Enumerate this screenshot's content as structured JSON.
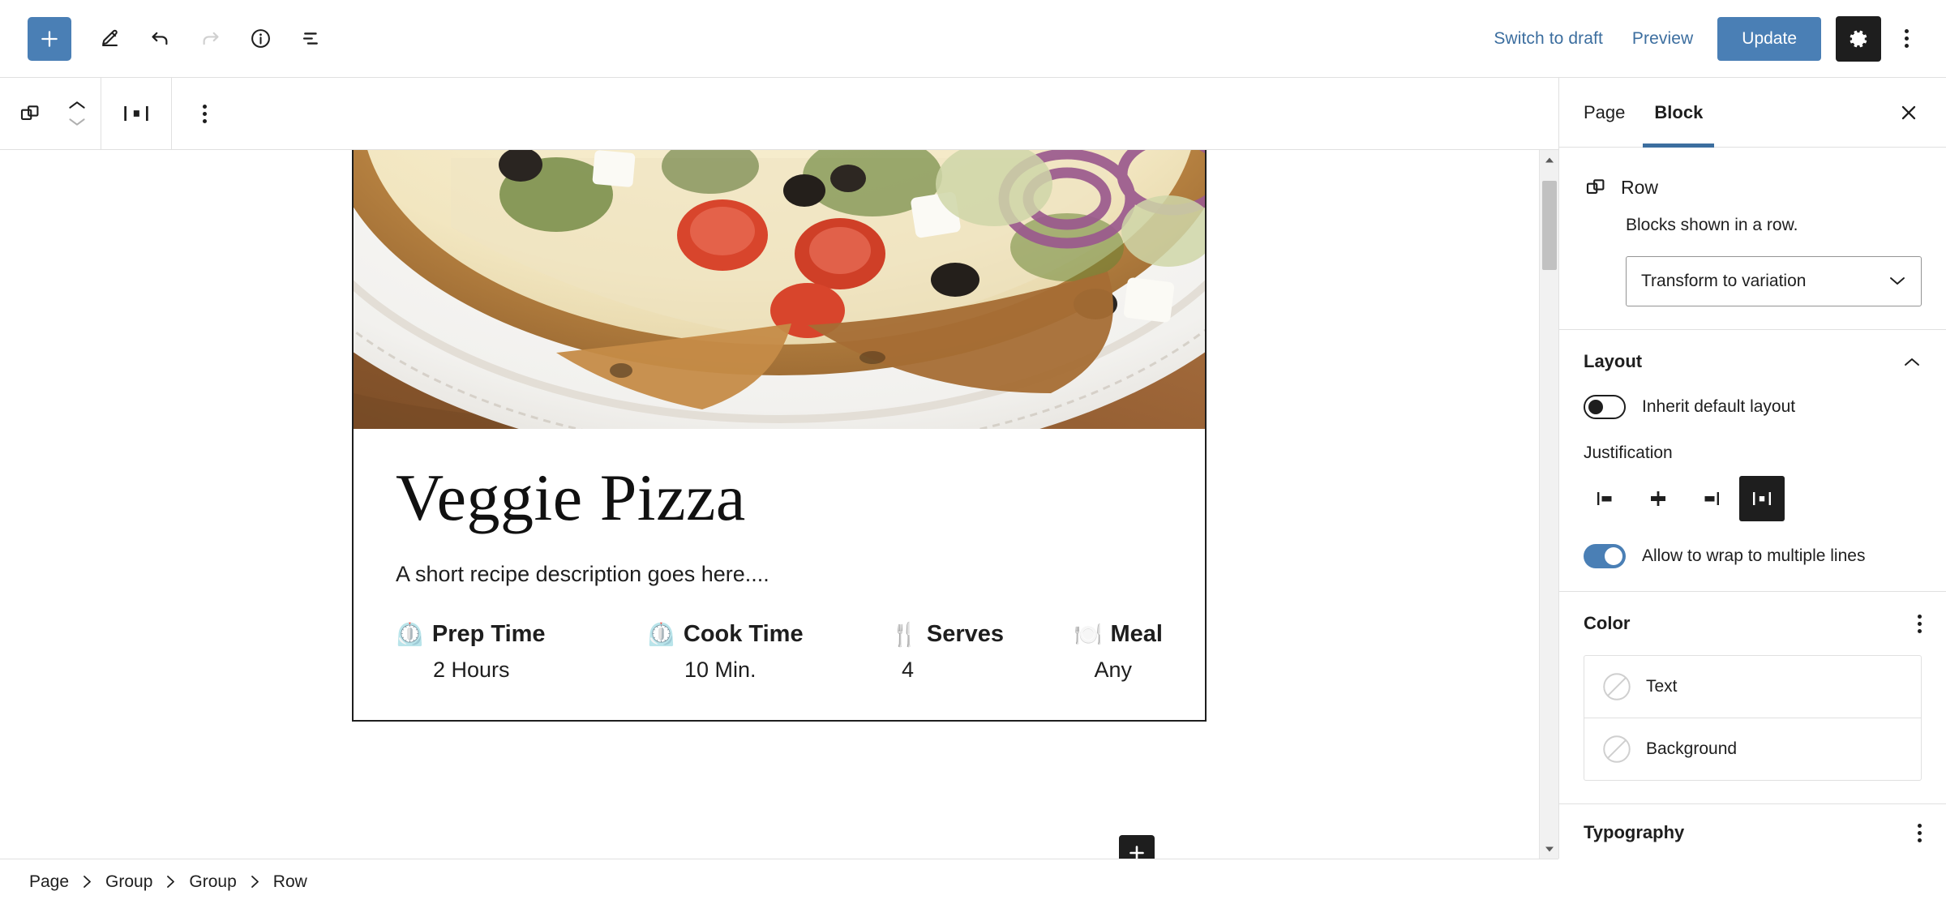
{
  "header": {
    "inserter_label": "+",
    "tools": [
      {
        "name": "add-block-inserter",
        "icon": "plus-icon"
      },
      {
        "name": "tools-pencil",
        "icon": "pencil-icon"
      },
      {
        "name": "undo",
        "icon": "undo-icon"
      },
      {
        "name": "redo",
        "icon": "redo-icon"
      },
      {
        "name": "details-info",
        "icon": "info-icon"
      },
      {
        "name": "list-view",
        "icon": "list-view-icon"
      }
    ],
    "switch_to_draft": "Switch to draft",
    "preview": "Preview",
    "update": "Update",
    "settings_icon": "gear-icon",
    "options_icon": "kebab-menu-icon",
    "accent_color": "#4a7fb5",
    "link_color": "#3c6e9f"
  },
  "block_toolbar": {
    "block_type_icon": "row-block-icon",
    "move_up_icon": "chevron-up-icon",
    "move_down_icon": "chevron-down-icon",
    "justify_icon": "justify-space-between-icon",
    "options_icon": "kebab-menu-icon"
  },
  "canvas": {
    "card": {
      "image_alt": "veggie pizza on a white plate",
      "title": "Veggie Pizza",
      "description": "A short recipe description goes here....",
      "meta": [
        {
          "emoji": "⏲️",
          "icon_name": "timer-emoji",
          "label": "Prep Time",
          "value": "2 Hours"
        },
        {
          "emoji": "⏲️",
          "icon_name": "timer-emoji",
          "label": "Cook Time",
          "value": "10 Min."
        },
        {
          "emoji": "🍴",
          "icon_name": "fork-knife-emoji",
          "label": "Serves",
          "value": "4"
        },
        {
          "emoji": "🍽️",
          "icon_name": "plate-emoji",
          "label": "Meal",
          "value": "Any"
        }
      ]
    },
    "appender_label": "+"
  },
  "sidebar": {
    "tabs": [
      {
        "label": "Page",
        "active": false
      },
      {
        "label": "Block",
        "active": true
      }
    ],
    "close_icon": "close-icon",
    "block": {
      "icon_name": "row-block-icon",
      "title": "Row",
      "description": "Blocks shown in a row.",
      "transform_select": "Transform to variation",
      "chevron": "chevron-down-icon"
    },
    "layout": {
      "title": "Layout",
      "collapse_icon": "chevron-up-icon",
      "inherit_toggle": {
        "label": "Inherit default layout",
        "state": "off"
      },
      "justification_label": "Justification",
      "justification_options": [
        {
          "name": "justify-left-icon",
          "active": false
        },
        {
          "name": "justify-center-icon",
          "active": false
        },
        {
          "name": "justify-right-icon",
          "active": false
        },
        {
          "name": "justify-space-between-icon",
          "active": true
        }
      ],
      "wrap_toggle": {
        "label": "Allow to wrap to multiple lines",
        "state": "on"
      }
    },
    "color": {
      "title": "Color",
      "options_icon": "kebab-menu-icon",
      "items": [
        {
          "label": "Text",
          "swatch": "none-circle-icon"
        },
        {
          "label": "Background",
          "swatch": "none-circle-icon"
        }
      ]
    },
    "typography": {
      "title": "Typography",
      "options_icon": "kebab-menu-icon"
    }
  },
  "footer": {
    "breadcrumbs": [
      "Page",
      "Group",
      "Group",
      "Row"
    ],
    "separator_icon": "chevron-right-icon"
  }
}
